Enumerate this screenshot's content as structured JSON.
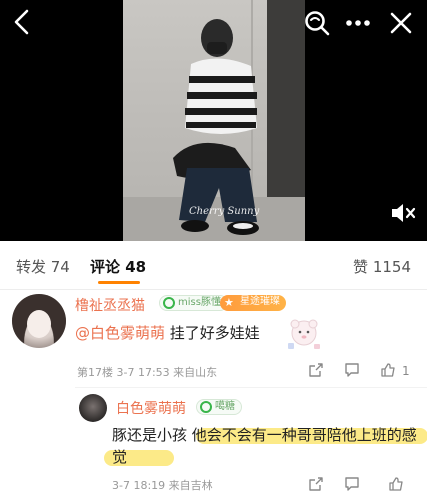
{
  "video": {
    "watermark": "Cherry Sunny"
  },
  "tabs": {
    "repost": "转发 74",
    "comments": "评论 48",
    "likes": "赞 1154"
  },
  "comment": {
    "username": "橹祉丞丞猫",
    "fan_badge": "miss豚懂",
    "star_badge": "星途璀璨",
    "mention": "@白色雾萌萌",
    "text": " 挂了好多娃娃",
    "meta": "第17楼  3-7 17:53  来自山东",
    "likes": "1"
  },
  "reply": {
    "username": "白色雾萌萌",
    "fan_badge": "噶糖",
    "text": "豚还是小孩 他会不会有一种哥哥陪他上班的感觉",
    "meta": "3-7 18:19  来自吉林"
  },
  "icons": {
    "top_bar": [
      "back-icon",
      "search-icon",
      "more-icon",
      "close-icon"
    ],
    "video": [
      "mute-icon"
    ],
    "actions": [
      "share-icon",
      "comment-icon",
      "like-icon"
    ]
  },
  "colors": {
    "accent": "#ff8200",
    "username": "#eb7350",
    "highlight": "#fbe56a"
  }
}
